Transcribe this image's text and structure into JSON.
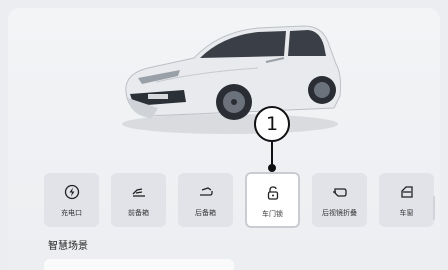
{
  "callout": {
    "number": "1"
  },
  "controls": [
    {
      "label": "充电口",
      "icon": "charging-port-icon",
      "active": false
    },
    {
      "label": "前备箱",
      "icon": "front-trunk-icon",
      "active": false
    },
    {
      "label": "后备箱",
      "icon": "rear-trunk-icon",
      "active": false
    },
    {
      "label": "车门锁",
      "icon": "door-lock-icon",
      "active": true
    },
    {
      "label": "后视镜折叠",
      "icon": "mirror-fold-icon",
      "active": false
    },
    {
      "label": "车窗",
      "icon": "car-window-icon",
      "active": false
    }
  ],
  "scene_section": {
    "title": "智慧场景"
  },
  "colors": {
    "panel": "#f3f4f6",
    "tile": "#e1e3e8",
    "active_tile": "#ffffff",
    "text": "#222222"
  }
}
